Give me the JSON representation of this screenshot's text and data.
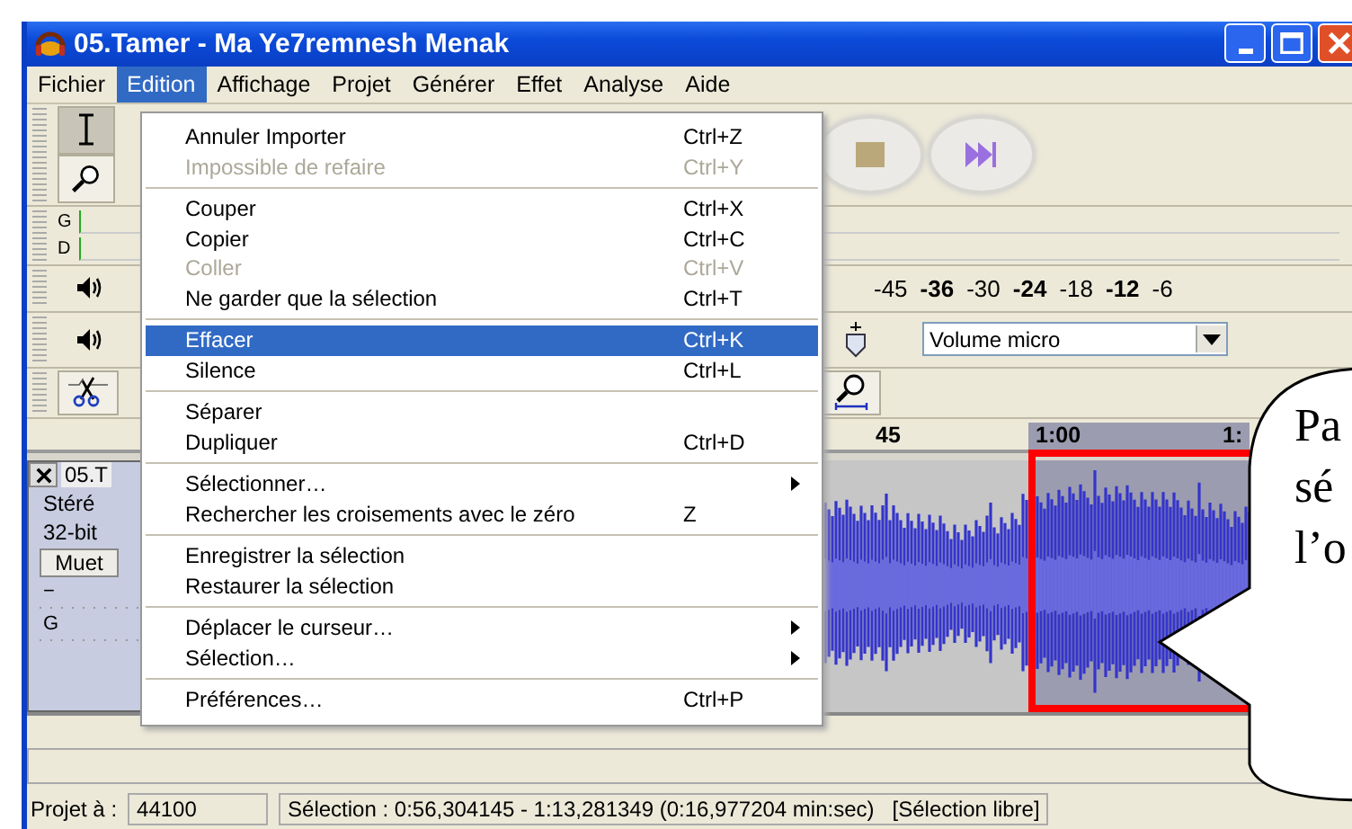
{
  "window": {
    "title": "05.Tamer - Ma Ye7remnesh Menak"
  },
  "menubar": [
    {
      "label": "Fichier",
      "selected": false
    },
    {
      "label": "Edition",
      "selected": true
    },
    {
      "label": "Affichage",
      "selected": false
    },
    {
      "label": "Projet",
      "selected": false
    },
    {
      "label": "Générer",
      "selected": false
    },
    {
      "label": "Effet",
      "selected": false
    },
    {
      "label": "Analyse",
      "selected": false
    },
    {
      "label": "Aide",
      "selected": false
    }
  ],
  "edit_menu": {
    "groups": [
      {
        "items": [
          {
            "label": "Annuler Importer",
            "shortcut": "Ctrl+Z",
            "disabled": false,
            "selected": false,
            "submenu": false
          },
          {
            "label": "Impossible de refaire",
            "shortcut": "Ctrl+Y",
            "disabled": true,
            "selected": false,
            "submenu": false
          }
        ]
      },
      {
        "items": [
          {
            "label": "Couper",
            "shortcut": "Ctrl+X",
            "disabled": false,
            "selected": false,
            "submenu": false
          },
          {
            "label": "Copier",
            "shortcut": "Ctrl+C",
            "disabled": false,
            "selected": false,
            "submenu": false
          },
          {
            "label": "Coller",
            "shortcut": "Ctrl+V",
            "disabled": true,
            "selected": false,
            "submenu": false
          },
          {
            "label": "Ne garder que la sélection",
            "shortcut": "Ctrl+T",
            "disabled": false,
            "selected": false,
            "submenu": false
          }
        ]
      },
      {
        "items": [
          {
            "label": "Effacer",
            "shortcut": "Ctrl+K",
            "disabled": false,
            "selected": true,
            "submenu": false
          },
          {
            "label": "Silence",
            "shortcut": "Ctrl+L",
            "disabled": false,
            "selected": false,
            "submenu": false
          }
        ]
      },
      {
        "items": [
          {
            "label": "Séparer",
            "disabled": false,
            "selected": false,
            "submenu": false
          },
          {
            "label": "Dupliquer",
            "shortcut": "Ctrl+D",
            "disabled": false,
            "selected": false,
            "submenu": false
          }
        ]
      },
      {
        "items": [
          {
            "label": "Sélectionner…",
            "disabled": false,
            "selected": false,
            "submenu": true
          },
          {
            "label": "Rechercher les croisements avec le zéro",
            "shortcut": "Z",
            "disabled": false,
            "selected": false,
            "submenu": false
          }
        ]
      },
      {
        "items": [
          {
            "label": "Enregistrer la sélection",
            "disabled": false,
            "selected": false,
            "submenu": false
          },
          {
            "label": "Restaurer la sélection",
            "disabled": false,
            "selected": false,
            "submenu": false
          }
        ]
      },
      {
        "items": [
          {
            "label": "Déplacer le curseur…",
            "disabled": false,
            "selected": false,
            "submenu": true
          },
          {
            "label": "Sélection…",
            "disabled": false,
            "selected": false,
            "submenu": true
          }
        ]
      },
      {
        "items": [
          {
            "label": "Préférences…",
            "shortcut": "Ctrl+P",
            "disabled": false,
            "selected": false,
            "submenu": false
          }
        ]
      }
    ]
  },
  "meter": {
    "channel_labels": [
      "G",
      "D"
    ],
    "scale": [
      {
        "label": "-45",
        "major": false
      },
      {
        "label": "-36",
        "major": true
      },
      {
        "label": "-30",
        "major": false
      },
      {
        "label": "-24",
        "major": true
      },
      {
        "label": "-18",
        "major": false
      },
      {
        "label": "-12",
        "major": true
      },
      {
        "label": "-6",
        "major": false
      }
    ]
  },
  "mixer": {
    "input_source": "Volume micro"
  },
  "ruler": {
    "labels": [
      "45",
      "1:00",
      "1:"
    ]
  },
  "track": {
    "name": "05.T",
    "info": [
      "Stéré",
      "32-bit"
    ],
    "mute_label": "Muet",
    "gain_label": "−",
    "pan_label": "G"
  },
  "callout": {
    "lines": [
      "Pa",
      "sé",
      "l’o"
    ]
  },
  "status_bar": {
    "project_rate_label": "Projet à :",
    "project_rate": "44100",
    "selection": "Sélection : 0:56,304145 - 1:13,281349 (0:16,977204 min:sec)",
    "selection_mode": "[Sélection libre]"
  }
}
